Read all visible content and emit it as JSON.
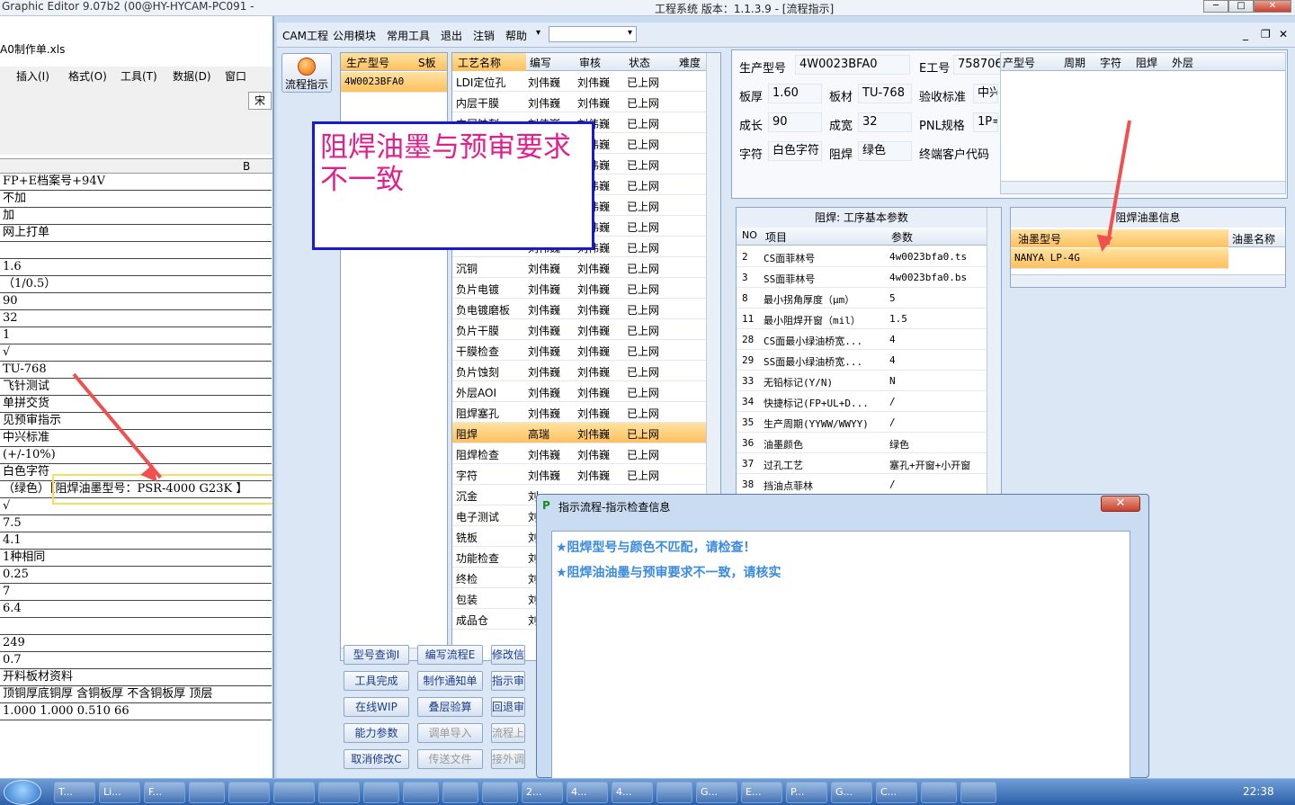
{
  "topbar": {
    "left_title": "Graphic Editor 9.07b2 (00@HY-HYCAM-PC091 -",
    "center_title": "工程系统   版本：1.1.3.9 - [流程指示]",
    "min": "─",
    "max": "□",
    "close": "✕"
  },
  "excel": {
    "filename": "A0制作单.xls",
    "menu": [
      "插入(I)",
      "格式(O)",
      "工具(T)",
      "数据(D)",
      "窗口(W)"
    ],
    "font_box": "宋",
    "col_header": "B",
    "rows": [
      "FP+E档案号+94V",
      "不加",
      "加",
      "网上打单",
      "",
      "1.6",
      "（1/0.5）",
      "90",
      "32",
      "1",
      "√",
      "TU-768",
      "飞针测试",
      "单拼交货",
      "见预审指示",
      "中兴标准",
      "(+/-10%)",
      "白色字符",
      "（绿色）【阻焊油墨型号：PSR-4000 G23K 】",
      "√",
      "7.5",
      "4.1",
      "1种相同",
      "0.25",
      "7",
      "6.4",
      "",
      "249",
      "0.7",
      "开料板材资料",
      "顶铜厚底铜厚 含铜板厚 不含铜板厚 顶层",
      "1.000  1.000         0.510          66"
    ]
  },
  "menubar": {
    "items": [
      "CAM工程",
      "公用模块",
      "常用工具",
      "退出",
      "注销",
      "帮助"
    ],
    "dropdown": "▾",
    "win_min": "_",
    "win_restore": "❐",
    "win_close": "✕"
  },
  "side": {
    "flow_label": "流程指示"
  },
  "product_list": {
    "headers": [
      "生产型号",
      "S板"
    ],
    "rows": [
      [
        "4W0023BFA0",
        ""
      ]
    ]
  },
  "process_list": {
    "headers": [
      "工艺名称",
      "编写",
      "审核",
      "状态",
      "难度"
    ],
    "rows": [
      [
        "LDI定位孔",
        "刘伟巍",
        "刘伟巍",
        "已上网"
      ],
      [
        "内层干膜",
        "刘伟巍",
        "刘伟巍",
        "已上网"
      ],
      [
        "内层蚀刻",
        "刘伟巍",
        "刘伟巍",
        "已上网"
      ],
      [
        "",
        "刘伟巍",
        "刘伟巍",
        "已上网"
      ],
      [
        "",
        "刘伟巍",
        "刘伟巍",
        "已上网"
      ],
      [
        "",
        "刘伟巍",
        "刘伟巍",
        "已上网"
      ],
      [
        "",
        "刘伟巍",
        "刘伟巍",
        "已上网"
      ],
      [
        "",
        "刘伟巍",
        "刘伟巍",
        "已上网"
      ],
      [
        "",
        "刘伟巍",
        "刘伟巍",
        "已上网"
      ],
      [
        "沉铜",
        "刘伟巍",
        "刘伟巍",
        "已上网"
      ],
      [
        "负片电镀",
        "刘伟巍",
        "刘伟巍",
        "已上网"
      ],
      [
        "负电镀磨板",
        "刘伟巍",
        "刘伟巍",
        "已上网"
      ],
      [
        "负片干膜",
        "刘伟巍",
        "刘伟巍",
        "已上网"
      ],
      [
        "干膜检查",
        "刘伟巍",
        "刘伟巍",
        "已上网"
      ],
      [
        "负片蚀刻",
        "刘伟巍",
        "刘伟巍",
        "已上网"
      ],
      [
        "外层AOI",
        "刘伟巍",
        "刘伟巍",
        "已上网"
      ],
      [
        "阻焊塞孔",
        "刘伟巍",
        "刘伟巍",
        "已上网"
      ],
      [
        "阻焊",
        "高瑞",
        "刘伟巍",
        "已上网"
      ],
      [
        "阻焊检查",
        "刘伟巍",
        "刘伟巍",
        "已上网"
      ],
      [
        "字符",
        "刘伟巍",
        "刘伟巍",
        "已上网"
      ],
      [
        "沉金",
        "刘",
        "",
        ""
      ],
      [
        "电子测试",
        "刘",
        "",
        ""
      ],
      [
        "铣板",
        "刘",
        "",
        ""
      ],
      [
        "功能检查",
        "刘",
        "",
        ""
      ],
      [
        "终检",
        "刘",
        "",
        ""
      ],
      [
        "包装",
        "刘",
        "",
        ""
      ],
      [
        "成品仓",
        "刘",
        "",
        ""
      ]
    ],
    "selected_index": 17
  },
  "buttons": [
    [
      "型号查询I",
      "编写流程E",
      "修改信"
    ],
    [
      "工具完成",
      "制作通知单",
      "指示审"
    ],
    [
      "在线WIP",
      "叠层验算",
      "回退审"
    ],
    [
      "能力参数",
      "调单导入",
      "流程上"
    ],
    [
      "取消修改C",
      "传送文件",
      "接外调"
    ]
  ],
  "info": {
    "labels": {
      "prod": "生产型号",
      "eno": "E工号",
      "thick": "板厚",
      "mat": "板材",
      "accept": "验收标准",
      "len": "成长",
      "wid": "成宽",
      "pnl": "PNL规格",
      "char": "字符",
      "mask": "阻焊",
      "cust": "终端客户代码"
    },
    "values": {
      "prod": "4W0023BFA0",
      "eno": "758706",
      "thick": "1.60",
      "mat": "TU-768",
      "accept": "中兴",
      "len": "90",
      "wid": "32",
      "pnl": "1P=",
      "char": "白色字符",
      "mask": "绿色"
    },
    "right_headers": [
      "产型号",
      "周期",
      "字符",
      "阻焊",
      "外层"
    ]
  },
  "params": {
    "title": "阻焊: 工序基本参数",
    "headers": [
      "NO",
      "项目",
      "参数"
    ],
    "rows": [
      [
        "2",
        "CS面菲林号",
        "4w0023bfa0.ts"
      ],
      [
        "3",
        "SS面菲林号",
        "4w0023bfa0.bs"
      ],
      [
        "8",
        "最小拐角厚度（μm）",
        "5"
      ],
      [
        "11",
        "最小阻焊开窗（mil）",
        "1.5"
      ],
      [
        "28",
        "CS面最小绿油桥宽...",
        "4"
      ],
      [
        "29",
        "SS面最小绿油桥宽...",
        "4"
      ],
      [
        "33",
        "无铅标记(Y/N)",
        "N"
      ],
      [
        "34",
        "快捷标记(FP+UL+D...",
        "/"
      ],
      [
        "35",
        "生产周期(YYWW/WWYY)",
        "/"
      ],
      [
        "36",
        "油墨颜色",
        "绿色"
      ],
      [
        "37",
        "过孔工艺",
        "塞孔+开窗+小开窗"
      ],
      [
        "38",
        "挡油点菲林",
        "/"
      ]
    ]
  },
  "ink": {
    "title": "阻焊油墨信息",
    "headers": [
      "油墨型号",
      "油墨名称"
    ],
    "rows": [
      [
        "NANYA LP-4G",
        ""
      ]
    ]
  },
  "note": "阻焊油墨与预审要求不一致",
  "dialog": {
    "title": "指示流程-指示检查信息",
    "close": "✕",
    "messages": [
      "★阻焊型号与颜色不匹配，请检查！",
      "★阻焊油油墨与预审要求不一致，请核实"
    ]
  },
  "taskbar": {
    "items": [
      "T...",
      "Li...",
      "F...",
      "",
      "",
      "",
      "",
      "",
      "",
      "",
      "",
      "2...",
      "4...",
      "4...",
      "",
      "G...",
      "E...",
      "P...",
      "G...",
      "C...",
      "",
      ""
    ],
    "clock": "22:38"
  },
  "colors": {
    "accent": "#ffc060",
    "annotation_border": "#1a1ac8",
    "annotation_text": "#e0208c",
    "message": "#3a8ae0",
    "arrow": "#f05050"
  }
}
